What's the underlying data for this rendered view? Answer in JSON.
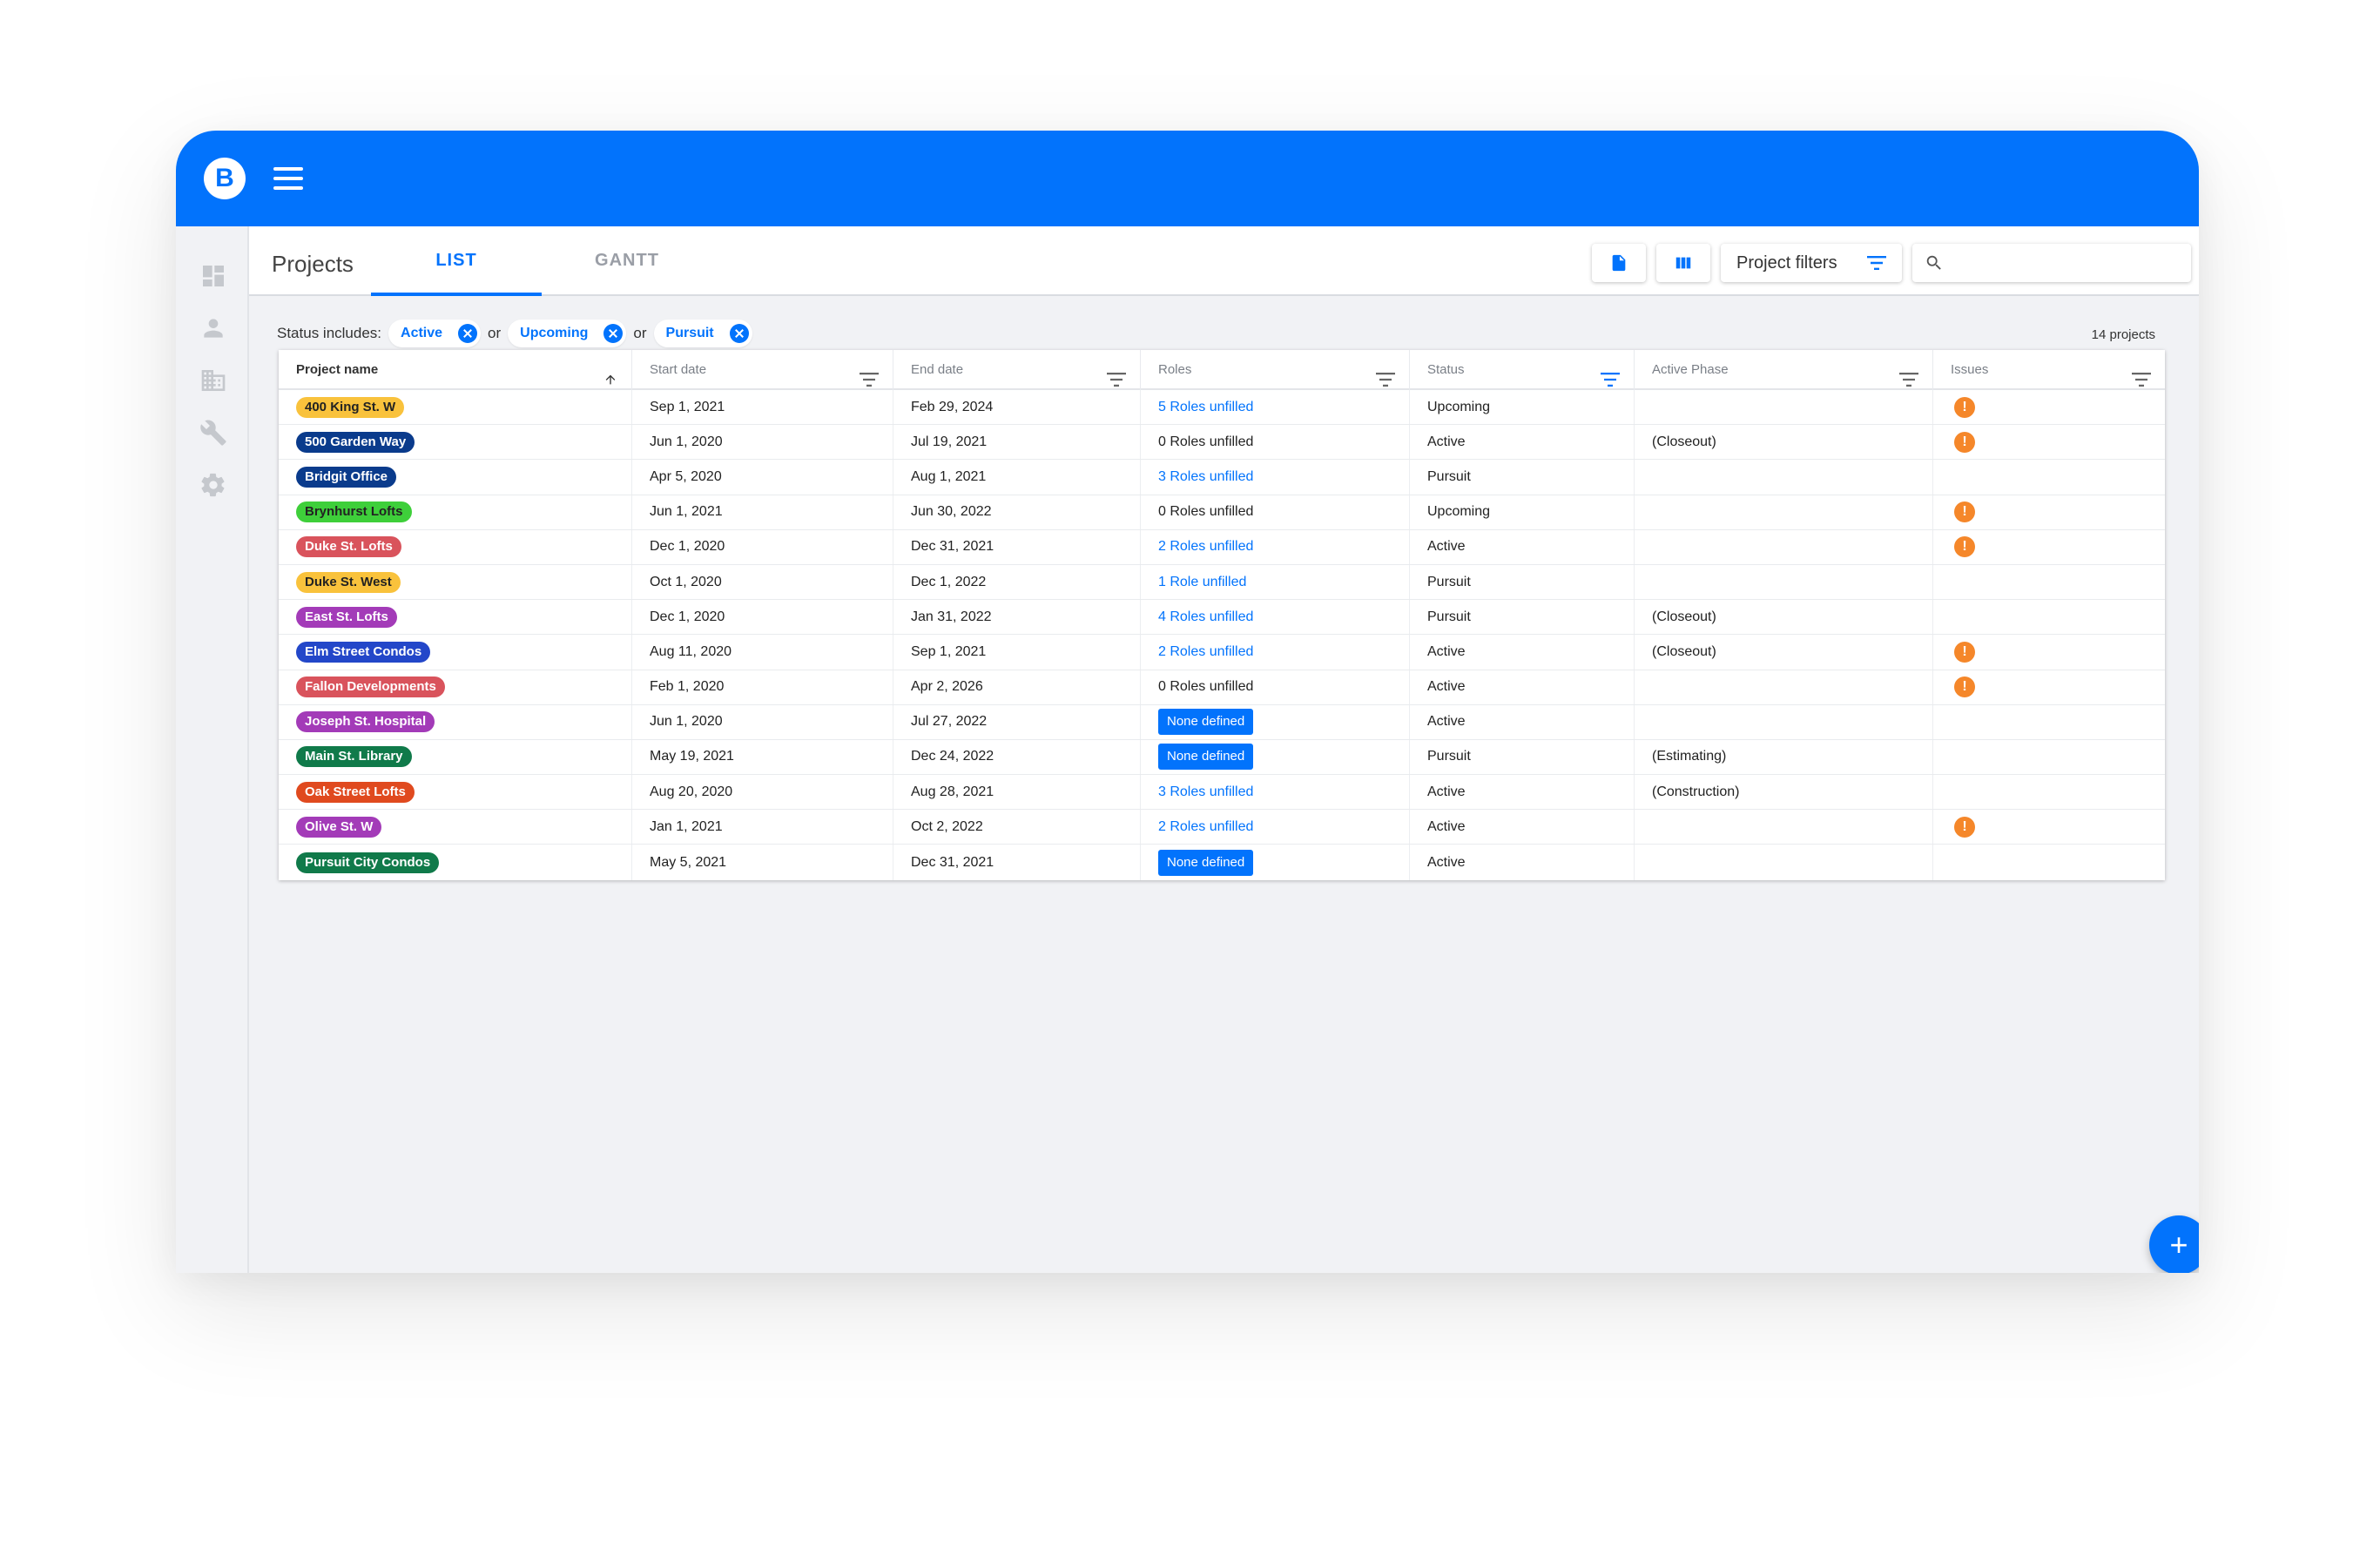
{
  "app": {
    "logo_letter": "B",
    "brand_color": "#0273fc"
  },
  "sidebar": {
    "items": [
      {
        "icon": "dashboard-icon"
      },
      {
        "icon": "person-icon"
      },
      {
        "icon": "building-icon"
      },
      {
        "icon": "wrench-icon"
      },
      {
        "icon": "gear-icon"
      }
    ]
  },
  "header": {
    "title": "Projects",
    "tabs": [
      {
        "label": "LIST",
        "active": true
      },
      {
        "label": "GANTT",
        "active": false
      }
    ],
    "filters_label": "Project filters",
    "search_placeholder": ""
  },
  "status_filter": {
    "label": "Status includes:",
    "separator": "or",
    "chips": [
      "Active",
      "Upcoming",
      "Pursuit"
    ]
  },
  "project_count": "14 projects",
  "table": {
    "columns": [
      "Project name",
      "Start date",
      "End date",
      "Roles",
      "Status",
      "Active Phase",
      "Issues"
    ],
    "rows": [
      {
        "name": "400 King St. W",
        "color": "#f9c23c",
        "text_color": "#222222",
        "start": "Sep 1, 2021",
        "end": "Feb 29, 2024",
        "roles": "5 Roles unfilled",
        "roles_type": "link",
        "status": "Upcoming",
        "phase": "",
        "issue": true
      },
      {
        "name": "500 Garden Way",
        "color": "#0a3b8c",
        "text_color": "#ffffff",
        "start": "Jun 1, 2020",
        "end": "Jul 19, 2021",
        "roles": "0 Roles unfilled",
        "roles_type": "plain",
        "status": "Active",
        "phase": "(Closeout)",
        "issue": true
      },
      {
        "name": "Bridgit Office",
        "color": "#0a3b8c",
        "text_color": "#ffffff",
        "start": "Apr 5, 2020",
        "end": "Aug 1, 2021",
        "roles": "3 Roles unfilled",
        "roles_type": "link",
        "status": "Pursuit",
        "phase": "",
        "issue": false
      },
      {
        "name": "Brynhurst Lofts",
        "color": "#3ecf3a",
        "text_color": "#222222",
        "start": "Jun 1, 2021",
        "end": "Jun 30, 2022",
        "roles": "0 Roles unfilled",
        "roles_type": "plain",
        "status": "Upcoming",
        "phase": "",
        "issue": true
      },
      {
        "name": "Duke St. Lofts",
        "color": "#d9535c",
        "text_color": "#ffffff",
        "start": "Dec 1, 2020",
        "end": "Dec 31, 2021",
        "roles": "2 Roles unfilled",
        "roles_type": "link",
        "status": "Active",
        "phase": "",
        "issue": true
      },
      {
        "name": "Duke St. West",
        "color": "#f9c23c",
        "text_color": "#222222",
        "start": "Oct 1, 2020",
        "end": "Dec 1, 2022",
        "roles": "1 Role unfilled",
        "roles_type": "link",
        "status": "Pursuit",
        "phase": "",
        "issue": false
      },
      {
        "name": "East St. Lofts",
        "color": "#a33bb8",
        "text_color": "#ffffff",
        "start": "Dec 1, 2020",
        "end": "Jan 31, 2022",
        "roles": "4 Roles unfilled",
        "roles_type": "link",
        "status": "Pursuit",
        "phase": "(Closeout)",
        "issue": false
      },
      {
        "name": "Elm Street Condos",
        "color": "#2347c9",
        "text_color": "#ffffff",
        "start": "Aug 11, 2020",
        "end": "Sep 1, 2021",
        "roles": "2 Roles unfilled",
        "roles_type": "link",
        "status": "Active",
        "phase": "(Closeout)",
        "issue": true
      },
      {
        "name": "Fallon Developments",
        "color": "#d9535c",
        "text_color": "#ffffff",
        "start": "Feb 1, 2020",
        "end": "Apr 2, 2026",
        "roles": "0 Roles unfilled",
        "roles_type": "plain",
        "status": "Active",
        "phase": "",
        "issue": true
      },
      {
        "name": "Joseph St. Hospital",
        "color": "#a33bb8",
        "text_color": "#ffffff",
        "start": "Jun 1, 2020",
        "end": "Jul 27, 2022",
        "roles": "None defined",
        "roles_type": "badge",
        "status": "Active",
        "phase": "",
        "issue": false
      },
      {
        "name": "Main St. Library",
        "color": "#107a4a",
        "text_color": "#ffffff",
        "start": "May 19, 2021",
        "end": "Dec 24, 2022",
        "roles": "None defined",
        "roles_type": "badge",
        "status": "Pursuit",
        "phase": "(Estimating)",
        "issue": false
      },
      {
        "name": "Oak Street Lofts",
        "color": "#e04a1f",
        "text_color": "#ffffff",
        "start": "Aug 20, 2020",
        "end": "Aug 28, 2021",
        "roles": "3 Roles unfilled",
        "roles_type": "link",
        "status": "Active",
        "phase": "(Construction)",
        "issue": false
      },
      {
        "name": "Olive St. W",
        "color": "#a33bb8",
        "text_color": "#ffffff",
        "start": "Jan 1, 2021",
        "end": "Oct 2, 2022",
        "roles": "2 Roles unfilled",
        "roles_type": "link",
        "status": "Active",
        "phase": "",
        "issue": true
      },
      {
        "name": "Pursuit City Condos",
        "color": "#107a4a",
        "text_color": "#ffffff",
        "start": "May 5, 2021",
        "end": "Dec 31, 2021",
        "roles": "None defined",
        "roles_type": "badge",
        "status": "Active",
        "phase": "",
        "issue": false
      }
    ]
  },
  "issue_glyph": "!",
  "fab_label": "+"
}
